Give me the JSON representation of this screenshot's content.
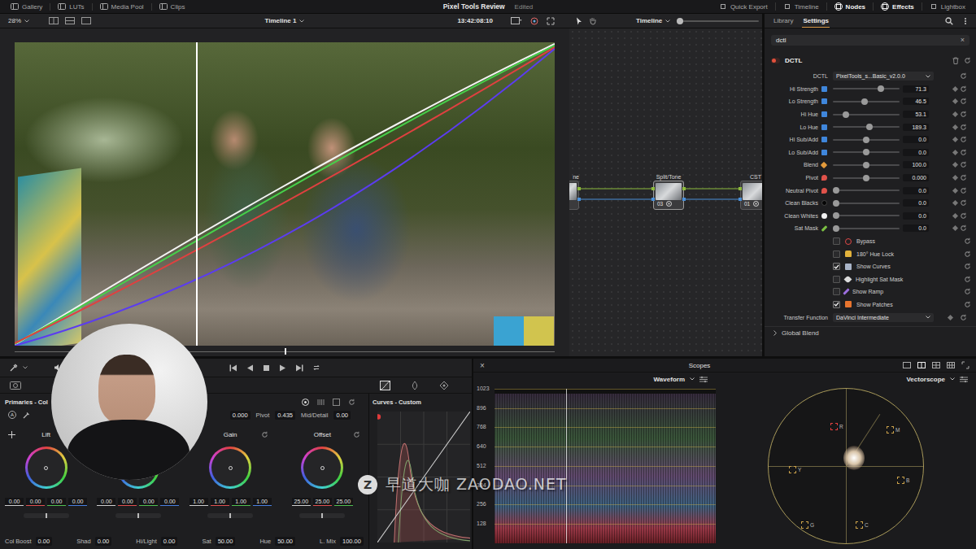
{
  "topbar": {
    "left": [
      {
        "label": "Gallery"
      },
      {
        "label": "LUTs"
      },
      {
        "label": "Media Pool"
      },
      {
        "label": "Clips"
      }
    ],
    "title": "Pixel Tools Review",
    "status": "Edited",
    "right": [
      {
        "label": "Quick Export",
        "selected": false
      },
      {
        "label": "Timeline",
        "selected": false
      },
      {
        "label": "Nodes",
        "selected": true
      },
      {
        "label": "Effects",
        "selected": true
      },
      {
        "label": "Lightbox",
        "selected": false
      }
    ]
  },
  "viewer": {
    "zoom": "28%",
    "timeline": "Timeline 1",
    "timecode": "13:42:08:10",
    "playhead": 0.5
  },
  "node_editor": {
    "mode": "Timeline",
    "zoom": 0.02,
    "nodes": [
      {
        "label": "ne"
      },
      {
        "label": "Split/Tone",
        "number": "03"
      },
      {
        "label": "CST",
        "number": "01"
      }
    ]
  },
  "settings": {
    "tabs": [
      {
        "label": "Library",
        "selected": false
      },
      {
        "label": "Settings",
        "selected": true
      }
    ],
    "search": {
      "value": "dctl",
      "clear": "×"
    },
    "effect": {
      "name": "DCTL",
      "enabled": true,
      "dctl": {
        "label": "DCTL",
        "value": "PixelTools_s...Basic_v2.0.0"
      },
      "sliders": [
        {
          "label": "Hi Strength",
          "value": "71.3",
          "level": 0.72
        },
        {
          "label": "Lo Strength",
          "value": "46.5",
          "level": 0.48
        },
        {
          "label": "Hi Hue",
          "value": "53.1",
          "level": 0.2
        },
        {
          "label": "Lo Hue",
          "value": "189.3",
          "level": 0.55
        },
        {
          "label": "Hi Sub/Add",
          "value": "0.0",
          "level": 0.5
        },
        {
          "label": "Lo Sub/Add",
          "value": "0.0",
          "level": 0.5
        },
        {
          "label": "Blend",
          "value": "100.0",
          "level": 0.5
        },
        {
          "label": "Pivot",
          "value": "0.000",
          "level": 0.5
        },
        {
          "label": "Neutral Pivot",
          "value": "0.0",
          "level": 0.05
        },
        {
          "label": "Clean Blacks",
          "value": "0.0",
          "level": 0.05
        },
        {
          "label": "Clean Whites",
          "value": "0.0",
          "level": 0.05
        },
        {
          "label": "Sat Mask",
          "value": "0.0",
          "level": 0.05
        }
      ],
      "checkboxes": [
        {
          "label": "Bypass",
          "checked": false
        },
        {
          "label": "180° Hue Lock",
          "checked": false
        },
        {
          "label": "Show Curves",
          "checked": true
        },
        {
          "label": "Highlight Sat Mask",
          "checked": false
        },
        {
          "label": "Show Ramp",
          "checked": false
        },
        {
          "label": "Show Patches",
          "checked": true
        }
      ],
      "transfer": {
        "label": "Transfer Function",
        "value": "DaVinci Intermediate"
      }
    },
    "global_blend": {
      "label": "Global Blend",
      "expanded": false
    }
  },
  "primaries": {
    "title": "Primaries - Col",
    "auto_balance": "A",
    "header_value": "0.000",
    "pivot_label": "Pivot",
    "pivot": "0.435",
    "mid_label": "Mid/Detail",
    "mid": "0.00",
    "wheels": [
      {
        "label": "Lift",
        "values": [
          "0.00",
          "0.00",
          "0.00",
          "0.00"
        ]
      },
      {
        "values": [
          "0.00",
          "0.00",
          "0.00",
          "0.00"
        ]
      },
      {
        "label": "Gain",
        "values": [
          "1.00",
          "1.00",
          "1.00",
          "1.00"
        ]
      },
      {
        "label": "Offset",
        "values": [
          "25.00",
          "25.00",
          "25.00"
        ]
      }
    ],
    "footer": [
      {
        "label": "Col Boost",
        "value": "0.00"
      },
      {
        "label": "Shad",
        "value": "0.00"
      },
      {
        "label": "Hi/Light",
        "value": "0.00"
      },
      {
        "label": "Sat",
        "value": "50.00"
      },
      {
        "label": "Hue",
        "value": "50.00"
      },
      {
        "label": "L. Mix",
        "value": "100.00"
      }
    ]
  },
  "curves": {
    "title": "Curves - Custom"
  },
  "scopes": {
    "title": "Scopes",
    "close": "×",
    "waveform": {
      "label": "Waveform",
      "ticks": [
        "1023",
        "896",
        "768",
        "640",
        "512",
        "384",
        "256",
        "128"
      ]
    },
    "vectorscope": {
      "label": "Vectorscope",
      "targets": [
        "R",
        "M",
        "B",
        "Y",
        "G",
        "C"
      ]
    }
  },
  "watermark": {
    "logo": "Z",
    "text": "早道大咖 ZAODAO.NET"
  }
}
